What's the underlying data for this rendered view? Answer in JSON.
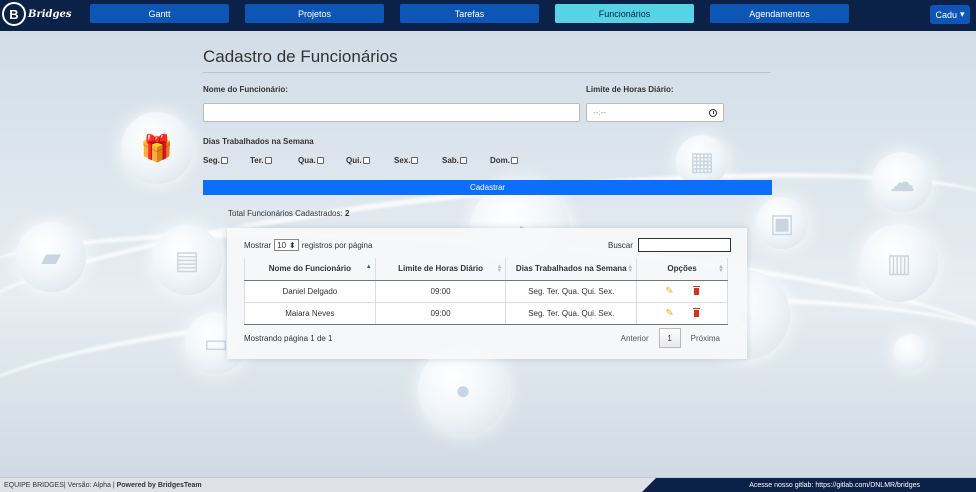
{
  "brand": {
    "letter": "B",
    "name": "Bridges"
  },
  "nav": {
    "items": [
      {
        "label": "Gantt"
      },
      {
        "label": "Projetos"
      },
      {
        "label": "Tarefas"
      },
      {
        "label": "Funcionários"
      },
      {
        "label": "Agendamentos"
      }
    ],
    "active": "Funcionários",
    "user": "Cadu",
    "user_caret": "▾"
  },
  "form": {
    "title": "Cadastro de Funcionários",
    "name_label": "Nome do Funcionário:",
    "name_value": "",
    "hours_label": "Limite de Horas Diário:",
    "hours_placeholder": "--:--",
    "days_label": "Dias Trabalhados na Semana",
    "days": [
      "Seg.",
      "Ter.",
      "Qua.",
      "Qui.",
      "Sex.",
      "Sab.",
      "Dom."
    ],
    "submit_label": "Cadastrar"
  },
  "total": {
    "label": "Total Funcionários Cadastrados:",
    "value": "2"
  },
  "table": {
    "show_label": "Mostrar",
    "page_size": "10",
    "per_page_label": "registros por página",
    "search_label": "Buscar",
    "search_value": "",
    "headers": [
      "Nome do Funcionário",
      "Limite de Horas Diário",
      "Dias Trabalhados na Semana",
      "Opções"
    ],
    "rows": [
      {
        "name": "Daniel Delgado",
        "hours": "09:00",
        "days": "Seg. Ter. Qua. Qui. Sex."
      },
      {
        "name": "Maiara Neves",
        "hours": "09:00",
        "days": "Seg. Ter. Qua. Qui. Sex."
      }
    ],
    "info": "Mostrando página 1 de 1",
    "prev_label": "Anterior",
    "current_page": "1",
    "next_label": "Próxima"
  },
  "footer": {
    "team": "EQUIPE BRIDGES",
    "version": "| Versão: Alpha |",
    "powered": "Powered by BridgesTeam",
    "gitlab": "Acesse nosso gitlab: https://gitlab.com/DNLMR/bridges"
  },
  "colors": {
    "navbar": "#0b2148",
    "nav_button": "#0d56b5",
    "nav_active": "#56d4e6",
    "primary": "#0d6efd",
    "edit": "#e3b80f",
    "delete": "#d9301c"
  }
}
